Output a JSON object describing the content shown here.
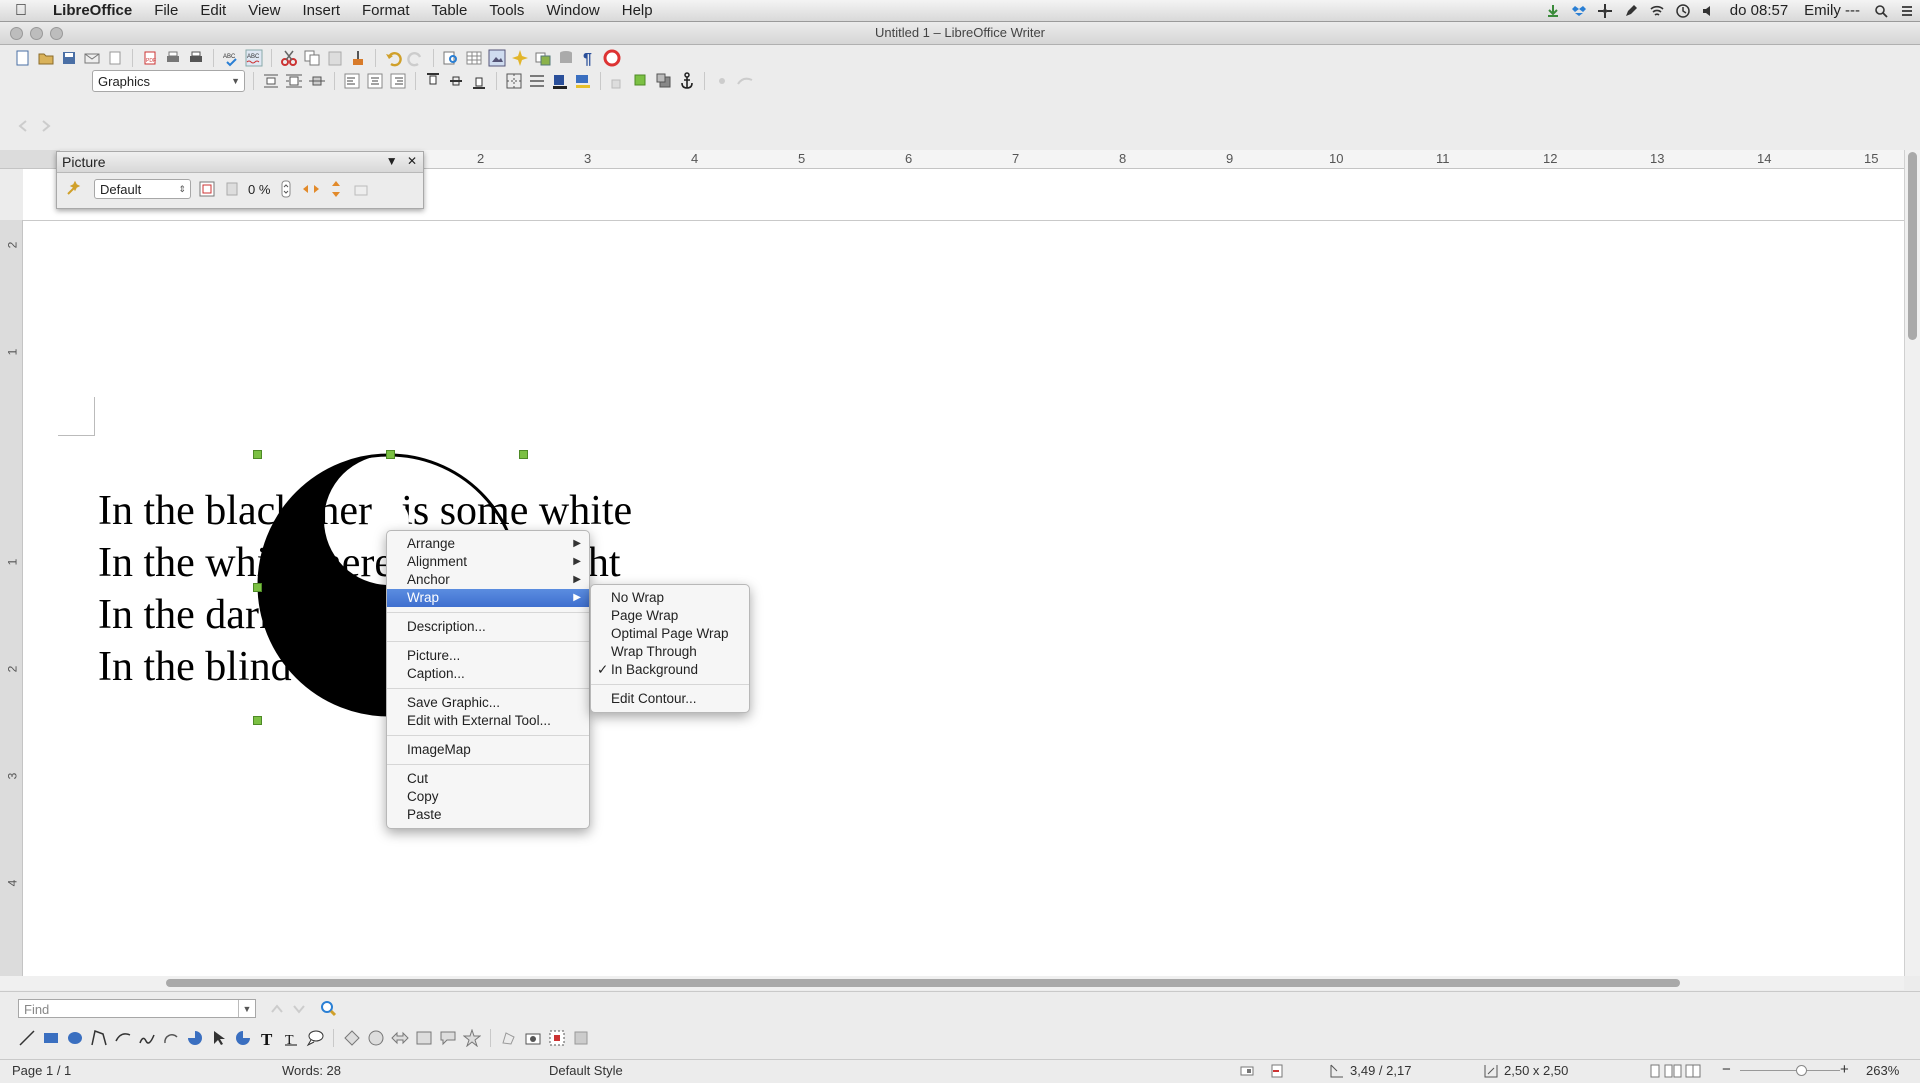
{
  "menubar": {
    "app": "LibreOffice",
    "items": [
      "File",
      "Edit",
      "View",
      "Insert",
      "Format",
      "Table",
      "Tools",
      "Window",
      "Help"
    ],
    "clock": "do 08:57",
    "user": "Emily ---"
  },
  "window": {
    "title": "Untitled 1 – LibreOffice Writer"
  },
  "toolbar": {
    "style_select": "Graphics"
  },
  "ruler": {
    "h_labels": [
      "2",
      "3",
      "4",
      "5",
      "6",
      "7",
      "8",
      "9",
      "10",
      "11",
      "12",
      "13",
      "14",
      "15"
    ],
    "v_labels": [
      "2",
      "1",
      "1",
      "2",
      "3",
      "4"
    ]
  },
  "picture_toolbar": {
    "title": "Picture",
    "mode": "Default",
    "transparency": "0 %"
  },
  "document": {
    "lines": [
      "In the black there is some white",
      "In the white there is some right",
      "In the dark there is some light",
      "In the blind there is some sight"
    ]
  },
  "context_menu": {
    "items": [
      {
        "label": "Arrange",
        "sub": true
      },
      {
        "label": "Alignment",
        "sub": true
      },
      {
        "label": "Anchor",
        "sub": true
      },
      {
        "label": "Wrap",
        "sub": true,
        "active": true
      },
      {
        "divider": true
      },
      {
        "label": "Description..."
      },
      {
        "divider": true
      },
      {
        "label": "Picture..."
      },
      {
        "label": "Caption..."
      },
      {
        "divider": true
      },
      {
        "label": "Save Graphic..."
      },
      {
        "label": "Edit with External Tool..."
      },
      {
        "divider": true
      },
      {
        "label": "ImageMap"
      },
      {
        "divider": true
      },
      {
        "label": "Cut"
      },
      {
        "label": "Copy"
      },
      {
        "label": "Paste"
      }
    ]
  },
  "wrap_submenu": {
    "items": [
      {
        "label": "No Wrap"
      },
      {
        "label": "Page Wrap"
      },
      {
        "label": "Optimal Page Wrap"
      },
      {
        "label": "Wrap Through"
      },
      {
        "label": "In Background",
        "checked": true
      },
      {
        "divider": true
      },
      {
        "label": "Edit Contour..."
      }
    ],
    "check_mark": "✓"
  },
  "find": {
    "placeholder": "Find"
  },
  "status": {
    "page": "Page 1 / 1",
    "words": "Words: 28",
    "style": "Default Style",
    "position": "3,49 / 2,17",
    "size": "2,50 x 2,50",
    "zoom": "263%"
  },
  "colors": {
    "accent": "#3f6fcf",
    "handle": "#7bc043"
  }
}
